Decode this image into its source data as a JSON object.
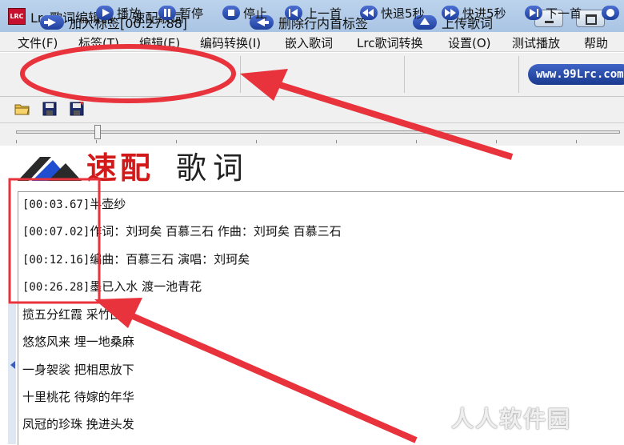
{
  "window": {
    "app_icon_text": "LRC",
    "title": "Lrc歌词编辑器 ~ 速配歌词"
  },
  "menu": [
    "文件(F)",
    "标签(T)",
    "编辑(E)",
    "编码转换(I)",
    "嵌入歌词",
    "Lrc歌词转换",
    "设置(O)",
    "测试播放",
    "帮助"
  ],
  "toolbar": {
    "add_tag": "加入标签[00:27.88]",
    "delete_tag": "删除行内首标签",
    "upload": "上传歌词",
    "site": "www.99Lrc.com"
  },
  "playback": {
    "play": "播放",
    "pause": "暂停",
    "stop": "停止",
    "prev": "上一首",
    "back5": "快退5秒",
    "fwd5": "快进5秒",
    "next": "下一首"
  },
  "logo": {
    "red": "速配",
    "black": "歌词"
  },
  "lyrics": [
    {
      "ts": "[00:03.67]",
      "text": "半壶纱"
    },
    {
      "ts": "[00:07.02]",
      "text": "作词：刘珂矣 百慕三石 作曲：刘珂矣 百慕三石"
    },
    {
      "ts": "[00:12.16]",
      "text": "编曲：百慕三石 演唱：刘珂矣"
    },
    {
      "ts": "[00:26.28]",
      "text": "墨已入水 渡一池青花"
    },
    {
      "ts": "",
      "text": "揽五分红霞 采竹回家"
    },
    {
      "ts": "",
      "text": "悠悠风来 埋一地桑麻"
    },
    {
      "ts": "",
      "text": "一身袈裟 把相思放下"
    },
    {
      "ts": "",
      "text": "十里桃花 待嫁的年华"
    },
    {
      "ts": "",
      "text": "凤冠的珍珠 挽进头发"
    }
  ],
  "watermark": "人人软件园",
  "colors": {
    "annotation_red": "#e8323c",
    "button_blue": "#2447a8",
    "logo_red": "#d31a1a"
  }
}
